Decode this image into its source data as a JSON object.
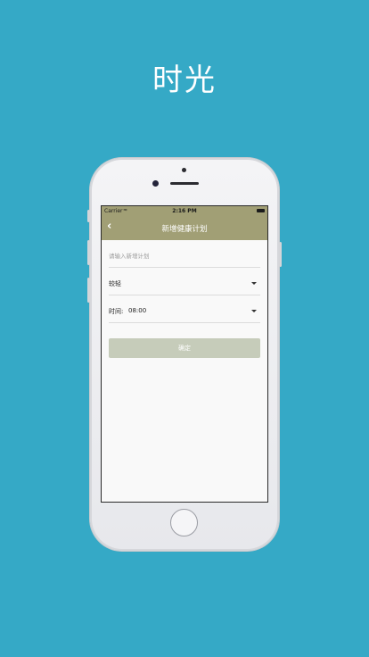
{
  "hero": {
    "title": "时光"
  },
  "status_bar": {
    "carrier": "Carrier",
    "time": "2:16 PM"
  },
  "nav": {
    "title": "新增健康计划"
  },
  "form": {
    "plan_placeholder": "请输入新增计划",
    "intensity_value": "较轻",
    "time_label": "时间:",
    "time_value": "08:00",
    "confirm_label": "确定"
  },
  "icons": {
    "back": "chevron-left-icon",
    "dropdown": "triangle-down-icon",
    "wifi": "wifi-icon",
    "battery": "battery-icon"
  },
  "colors": {
    "background": "#35a9c6",
    "nav_bar": "#a19f75",
    "confirm_button": "#c6ccba"
  }
}
